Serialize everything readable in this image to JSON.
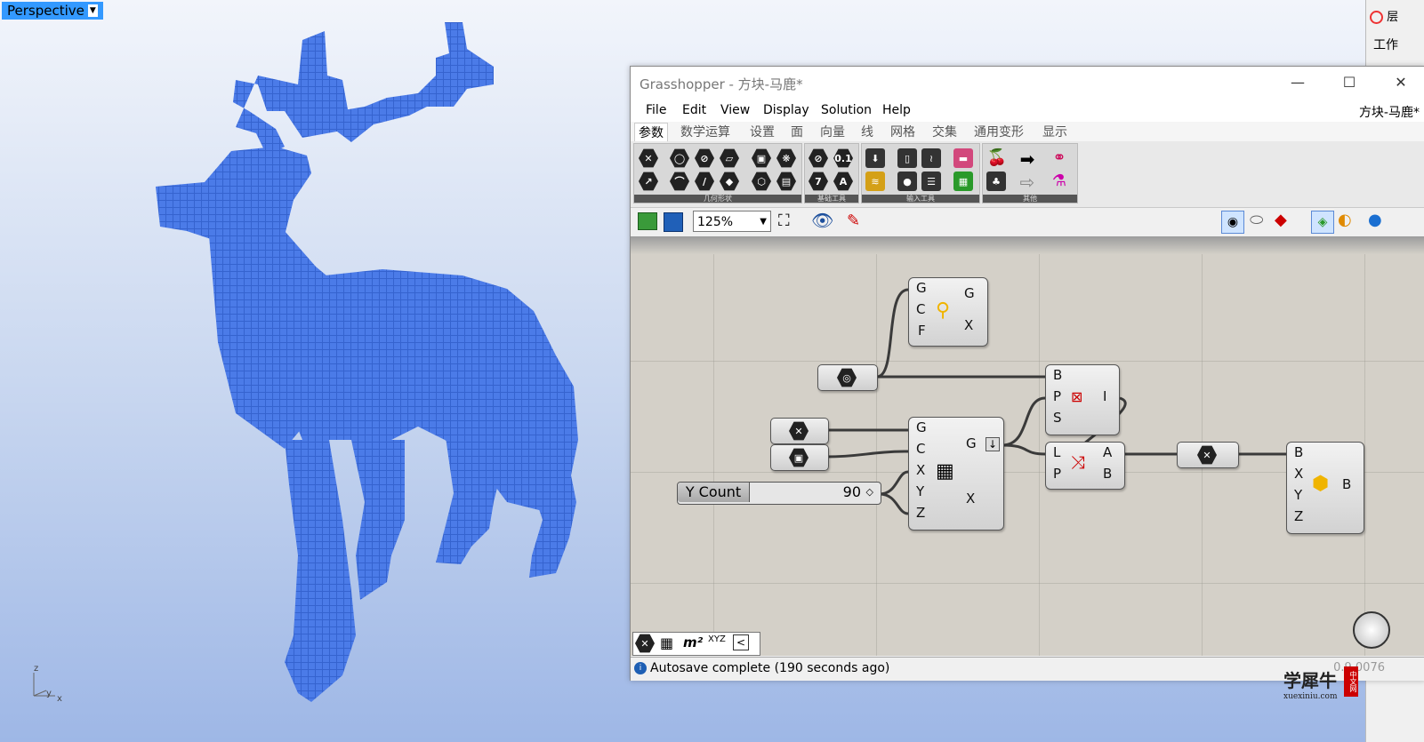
{
  "viewport": {
    "label": "Perspective",
    "axes": {
      "z": "z",
      "y": "y",
      "x": "x"
    },
    "model_color": "#4b7be8"
  },
  "right_panel": {
    "item1": "层",
    "item2": "工作"
  },
  "gh": {
    "title": "Grasshopper - 方块-马鹿*",
    "doc_name": "方块-马鹿*",
    "menu": [
      "File",
      "Edit",
      "View",
      "Display",
      "Solution",
      "Help"
    ],
    "tabs": [
      "参数",
      "数学运算",
      "设置",
      "面",
      "向量",
      "线",
      "网格",
      "交集",
      "通用变形",
      "显示"
    ],
    "ribbon_groups": [
      "几何形状",
      "基础工具",
      "输入工具",
      "其他"
    ],
    "zoom": "125%",
    "status": "Autosave complete (190 seconds ago)",
    "version": "0.9.0076"
  },
  "components": {
    "top": {
      "inputs": [
        "G",
        "C",
        "F"
      ],
      "outputs": [
        "G",
        "X"
      ]
    },
    "grid": {
      "inputs": [
        "G",
        "C",
        "X",
        "Y",
        "Z"
      ],
      "outputs": [
        "G",
        "X"
      ]
    },
    "point_in": {
      "inputs": [
        "B",
        "P",
        "S"
      ],
      "outputs": [
        "I"
      ]
    },
    "dispatch": {
      "inputs": [
        "L",
        "P"
      ],
      "outputs": [
        "A",
        "B"
      ]
    },
    "box": {
      "inputs": [
        "B",
        "X",
        "Y",
        "Z"
      ],
      "outputs": [
        "B"
      ]
    }
  },
  "slider": {
    "label": "Y Count",
    "value": "90"
  },
  "canvas_toolbar": {
    "m2": "m²",
    "xyz": "XYZ"
  },
  "logo": {
    "text": "学犀牛",
    "url": "xuexiniu.com",
    "badge": "中文网"
  }
}
